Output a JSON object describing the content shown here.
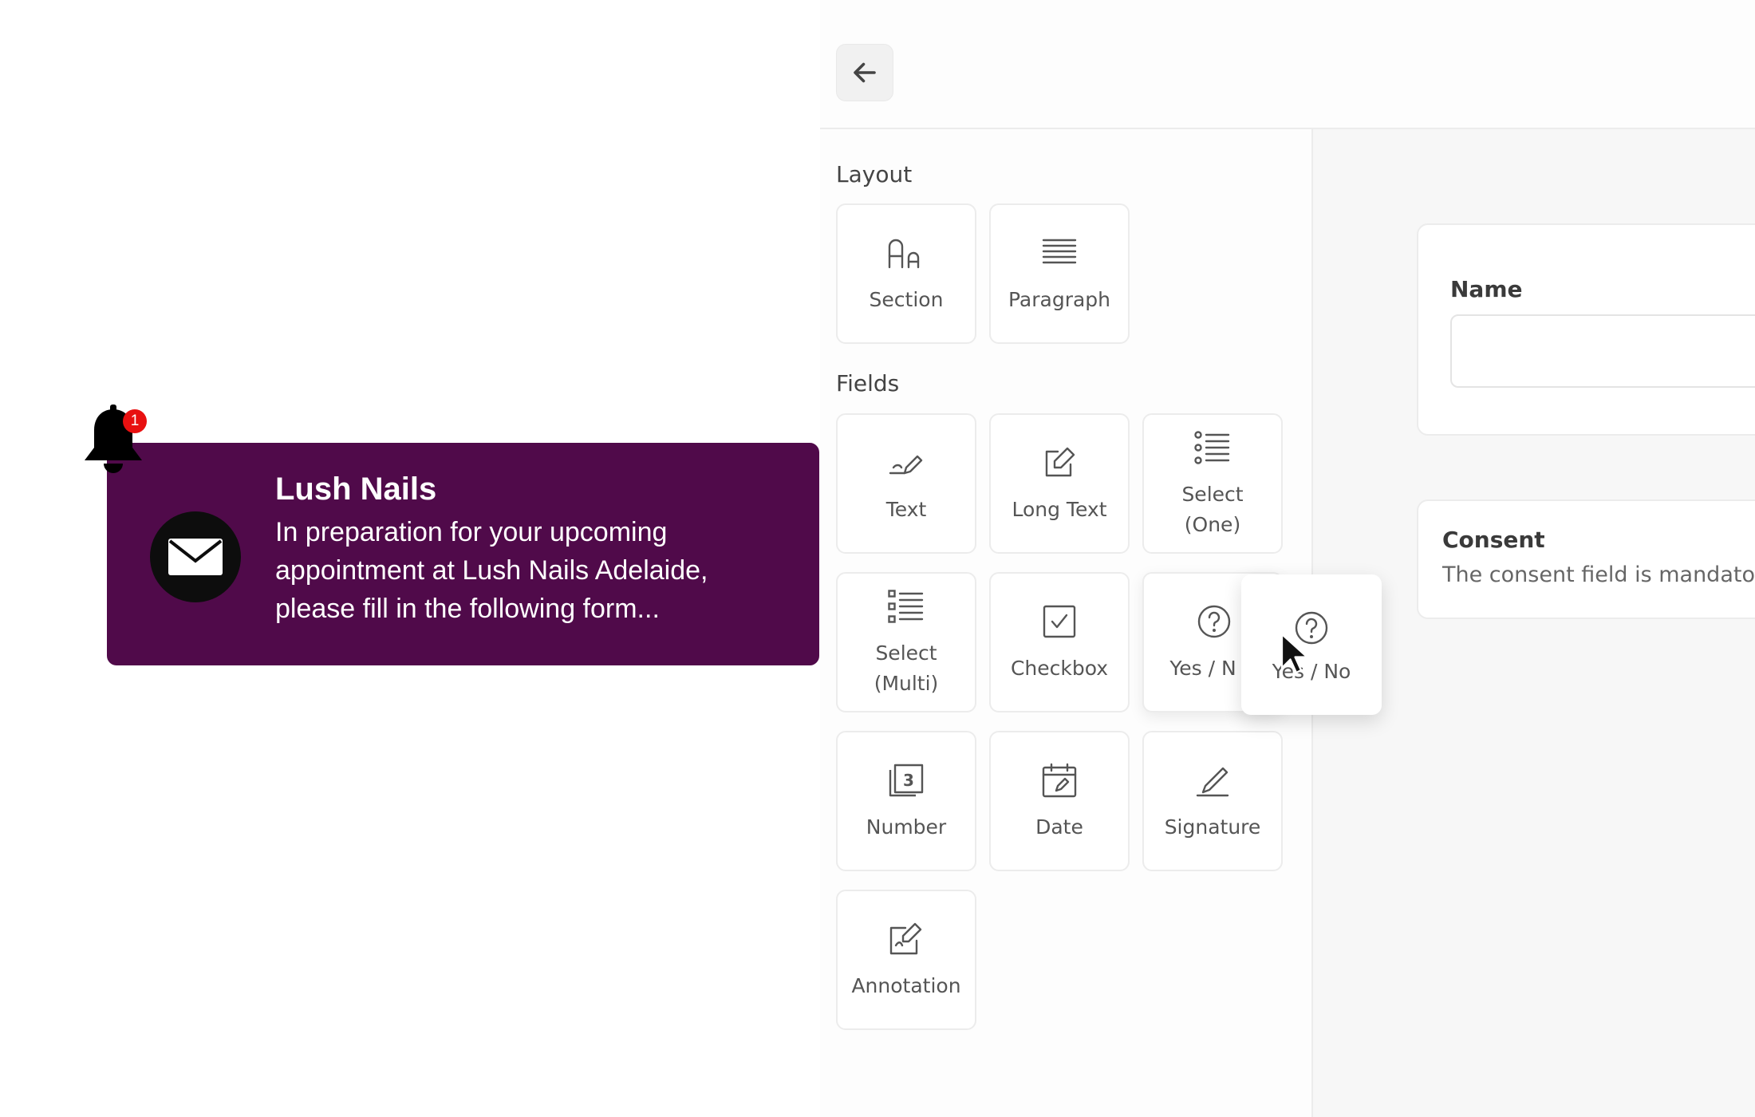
{
  "notification": {
    "badge_count": "1",
    "title": "Lush Nails",
    "body": "In preparation for your upcoming appointment at Lush Nails Adelaide, please fill in the following form..."
  },
  "palette": {
    "layout_heading": "Layout",
    "fields_heading": "Fields",
    "layout_items": [
      {
        "label": "Section",
        "icon": "section-icon"
      },
      {
        "label": "Paragraph",
        "icon": "paragraph-icon"
      }
    ],
    "field_items": [
      {
        "label": "Text",
        "icon": "pen-icon"
      },
      {
        "label": "Long Text",
        "icon": "edit-icon"
      },
      {
        "label": "Select (One)",
        "icon": "list-icon"
      },
      {
        "label": "Select (Multi)",
        "icon": "list-icon"
      },
      {
        "label": "Checkbox",
        "icon": "checkbox-icon"
      },
      {
        "label": "Yes / No",
        "icon": "question-icon"
      },
      {
        "label": "Number",
        "icon": "number-icon"
      },
      {
        "label": "Date",
        "icon": "calendar-icon"
      },
      {
        "label": "Signature",
        "icon": "signature-icon"
      },
      {
        "label": "Annotation",
        "icon": "annotation-icon"
      }
    ],
    "yesno_clipped_label": "Yes / N",
    "drag_ghost_label": "Yes / No"
  },
  "form": {
    "name_label": "Name",
    "consent_label": "Consent",
    "consent_description": "The consent field is mandato"
  }
}
